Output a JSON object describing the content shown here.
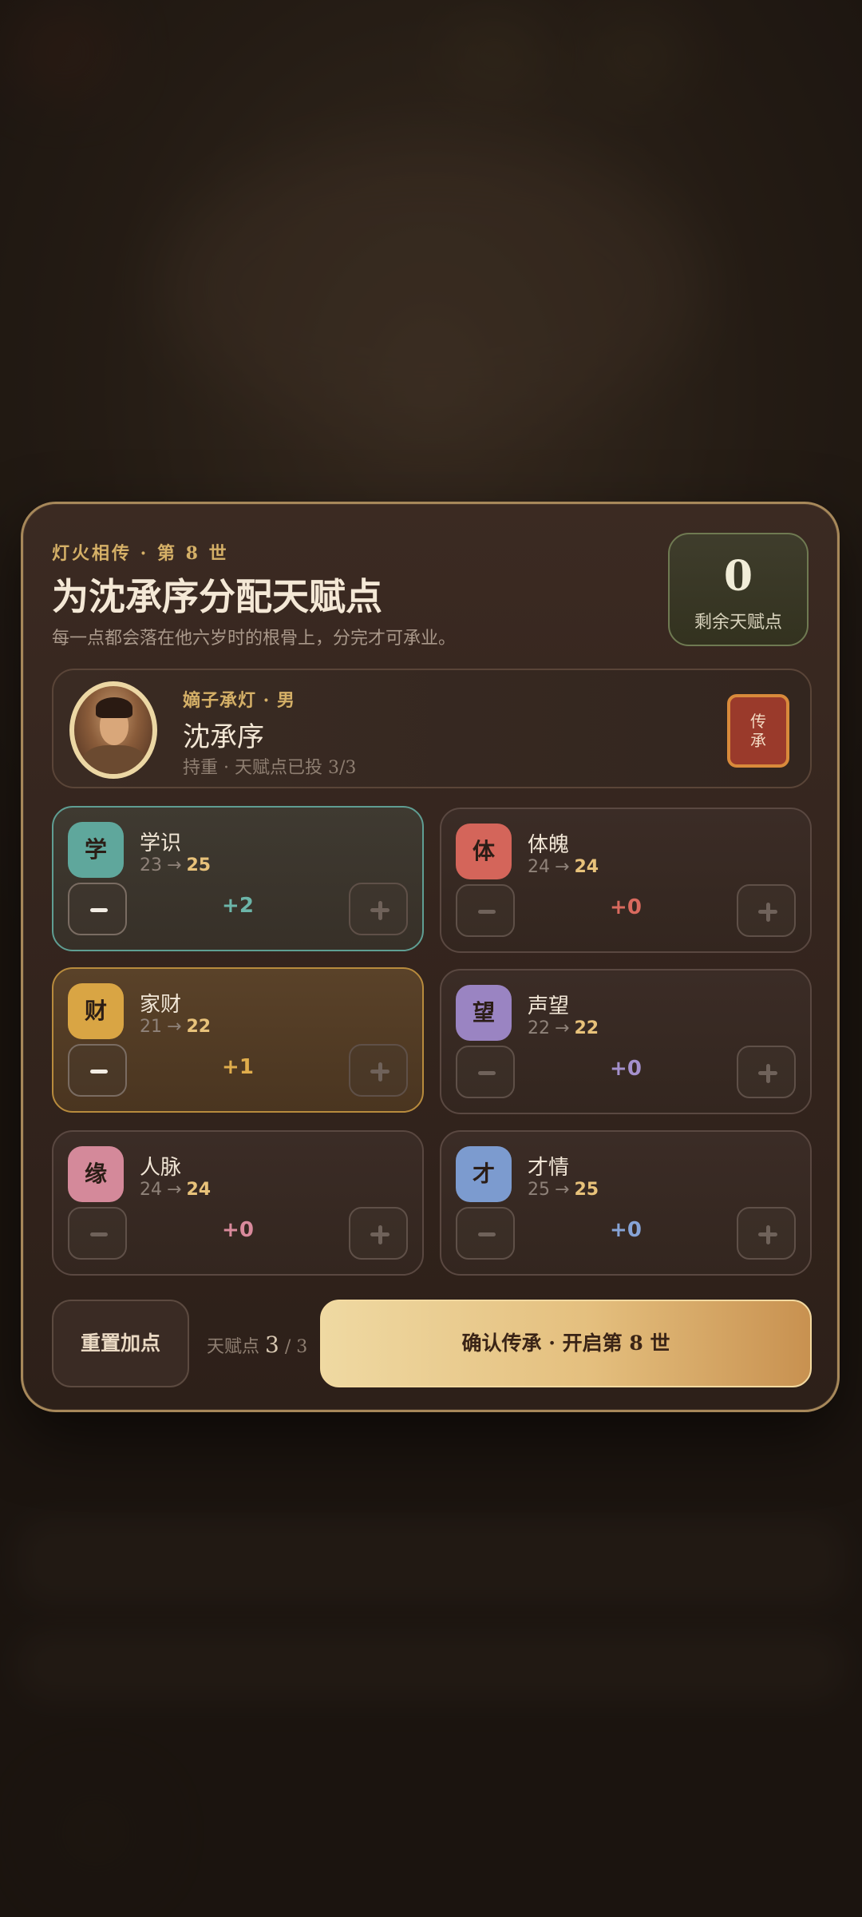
{
  "header": {
    "eyebrow": "灯火相传 · 第 8 世",
    "title": "为沈承序分配天赋点",
    "subtitle": "每一点都会落在他六岁时的根骨上，分完才可承业。"
  },
  "remaining": {
    "value": "0",
    "label": "剩余天赋点"
  },
  "heir": {
    "subtitle": "嫡子承灯 · 男",
    "name": "沈承序",
    "meta": "持重 · 天赋点已投 3/3",
    "seal": "传承"
  },
  "attributes": [
    {
      "badge": "学",
      "name": "学识",
      "base": "23",
      "arrow": "→",
      "new": "25",
      "delta": "+2",
      "color": "#5fa79c",
      "delta_color": "#6cb5a9"
    },
    {
      "badge": "体",
      "name": "体魄",
      "base": "24",
      "arrow": "→",
      "new": "24",
      "delta": "+0",
      "color": "#d4655a",
      "delta_color": "#d96a5e"
    },
    {
      "badge": "财",
      "name": "家财",
      "base": "21",
      "arrow": "→",
      "new": "22",
      "delta": "+1",
      "color": "#d9a544",
      "delta_color": "#e0ad4c"
    },
    {
      "badge": "望",
      "name": "声望",
      "base": "22",
      "arrow": "→",
      "new": "22",
      "delta": "+0",
      "color": "#9a84c2",
      "delta_color": "#a490cc"
    },
    {
      "badge": "缘",
      "name": "人脉",
      "base": "24",
      "arrow": "→",
      "new": "24",
      "delta": "+0",
      "color": "#d4899a",
      "delta_color": "#d98a9c"
    },
    {
      "badge": "才",
      "name": "才情",
      "base": "25",
      "arrow": "→",
      "new": "25",
      "delta": "+0",
      "color": "#7c9bcf",
      "delta_color": "#86a3d6"
    }
  ],
  "footer": {
    "reset_label": "重置加点",
    "alloc_label": "天赋点",
    "alloc_used": "3",
    "alloc_sep": "/",
    "alloc_total": "3",
    "confirm_label": "确认传承 · 开启第 8 世"
  }
}
